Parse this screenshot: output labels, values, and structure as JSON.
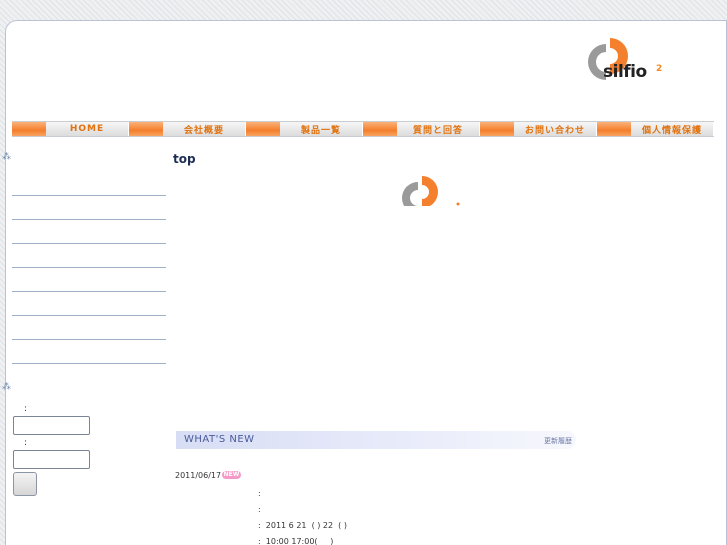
{
  "logo": {
    "text": "silfio",
    "sup": "2"
  },
  "nav": [
    {
      "label": "HOME"
    },
    {
      "label": "会社概要"
    },
    {
      "label": "製品一覧"
    },
    {
      "label": "質問と回答"
    },
    {
      "label": "お問い合わせ"
    },
    {
      "label": "個人情報保護"
    }
  ],
  "main": {
    "title": "top",
    "whats_new": {
      "title": "WHAT'S NEW",
      "link": "更新履歴"
    },
    "news": {
      "date": "2011/06/17",
      "badge": "NEW",
      "lines": [
        ":",
        ":",
        ":  2011 6 21  ( ) 22  ( )",
        ":  10:00 17:00(     )"
      ]
    }
  },
  "sidebar": {
    "colon1": ":",
    "colon2": ":"
  },
  "colors": {
    "accent_orange": "#f47f2c",
    "heading_navy": "#1c2d55"
  }
}
